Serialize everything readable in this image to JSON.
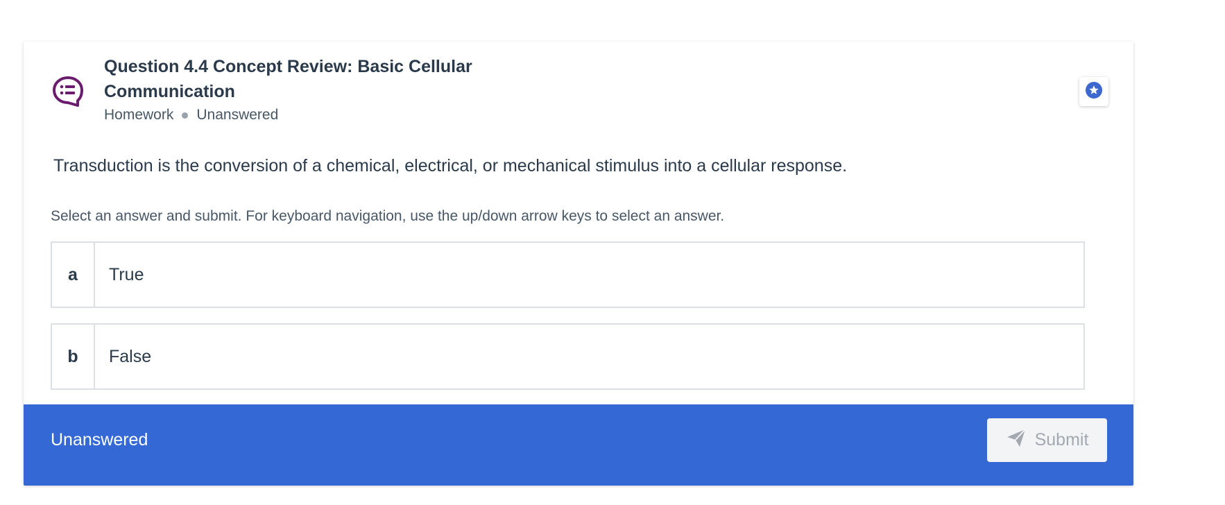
{
  "question": {
    "title": "Question 4.4 Concept Review: Basic Cellular Communication",
    "type_icon": "question-bubble-icon",
    "category": "Homework",
    "status": "Unanswered",
    "bookmark_icon": "star-icon",
    "prompt": "Transduction is the conversion of a chemical, electrical, or mechanical stimulus into a cellular response.",
    "instructions": "Select an answer and submit. For keyboard navigation, use the up/down arrow keys to select an answer."
  },
  "options": [
    {
      "letter": "a",
      "text": "True"
    },
    {
      "letter": "b",
      "text": "False"
    }
  ],
  "footer": {
    "status": "Unanswered",
    "submit_label": "Submit",
    "submit_icon": "paper-plane-icon"
  },
  "colors": {
    "accent": "#3468d4",
    "icon_purple": "#6b1c6e",
    "bookmark_blue": "#3c68d0"
  }
}
